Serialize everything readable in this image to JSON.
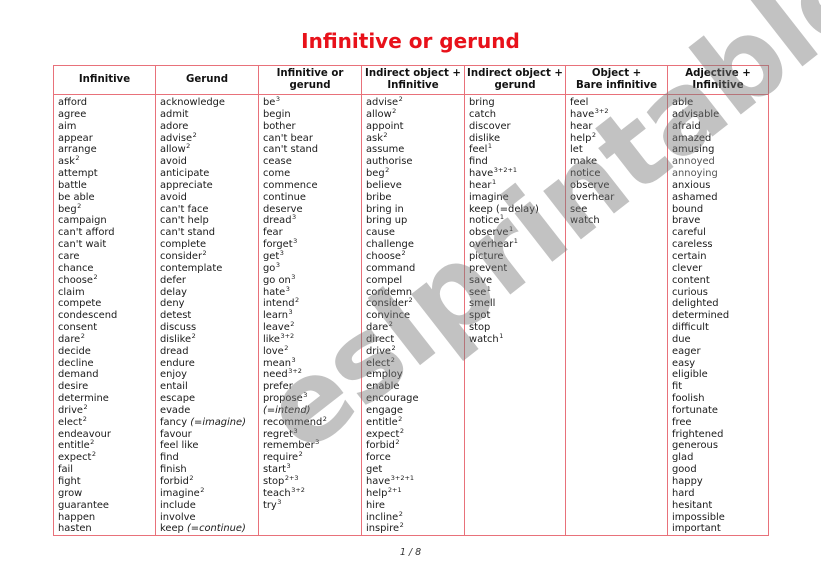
{
  "title": "Infinitive or gerund",
  "page_number": "1 / 8",
  "watermark": "eslprintables.com",
  "colors": {
    "title": "#e8111a",
    "border": "#e8717a"
  },
  "columns": [
    {
      "header": [
        "Infinitive",
        ""
      ],
      "items": [
        {
          "w": "afford"
        },
        {
          "w": "agree"
        },
        {
          "w": "aim"
        },
        {
          "w": "appear"
        },
        {
          "w": "arrange"
        },
        {
          "w": "ask",
          "sup": "2"
        },
        {
          "w": "attempt"
        },
        {
          "w": "battle"
        },
        {
          "w": "be able"
        },
        {
          "w": "beg",
          "sup": "2"
        },
        {
          "w": "campaign"
        },
        {
          "w": "can't afford"
        },
        {
          "w": "can't wait"
        },
        {
          "w": "care"
        },
        {
          "w": "chance"
        },
        {
          "w": "choose",
          "sup": "2"
        },
        {
          "w": "claim"
        },
        {
          "w": "compete"
        },
        {
          "w": "condescend"
        },
        {
          "w": "consent"
        },
        {
          "w": "dare",
          "sup": "2"
        },
        {
          "w": "decide"
        },
        {
          "w": "decline"
        },
        {
          "w": "demand"
        },
        {
          "w": "desire"
        },
        {
          "w": "determine"
        },
        {
          "w": "drive",
          "sup": "2"
        },
        {
          "w": "elect",
          "sup": "2"
        },
        {
          "w": "endeavour"
        },
        {
          "w": "entitle",
          "sup": "2"
        },
        {
          "w": "expect",
          "sup": "2"
        },
        {
          "w": "fail"
        },
        {
          "w": "fight"
        },
        {
          "w": "grow"
        },
        {
          "w": "guarantee"
        },
        {
          "w": "happen"
        },
        {
          "w": "hasten"
        }
      ]
    },
    {
      "header": [
        "Gerund",
        ""
      ],
      "items": [
        {
          "w": "acknowledge"
        },
        {
          "w": "admit"
        },
        {
          "w": "adore"
        },
        {
          "w": "advise",
          "sup": "2"
        },
        {
          "w": "allow",
          "sup": "2"
        },
        {
          "w": "avoid"
        },
        {
          "w": "anticipate"
        },
        {
          "w": "appreciate"
        },
        {
          "w": "avoid"
        },
        {
          "w": "can't face"
        },
        {
          "w": "can't help"
        },
        {
          "w": "can't stand"
        },
        {
          "w": "complete"
        },
        {
          "w": "consider",
          "sup": "2"
        },
        {
          "w": "contemplate"
        },
        {
          "w": "defer"
        },
        {
          "w": "delay"
        },
        {
          "w": "deny"
        },
        {
          "w": "detest"
        },
        {
          "w": "discuss"
        },
        {
          "w": "dislike",
          "sup": "2"
        },
        {
          "w": "dread"
        },
        {
          "w": "endure"
        },
        {
          "w": "enjoy"
        },
        {
          "w": "entail"
        },
        {
          "w": "escape"
        },
        {
          "w": "evade"
        },
        {
          "w": "fancy",
          "note": "(=imagine)"
        },
        {
          "w": "favour"
        },
        {
          "w": "feel like"
        },
        {
          "w": "find"
        },
        {
          "w": "finish"
        },
        {
          "w": "forbid",
          "sup": "2"
        },
        {
          "w": "imagine",
          "sup": "2"
        },
        {
          "w": "include"
        },
        {
          "w": "involve"
        },
        {
          "w": "keep",
          "note": "(=continue)"
        }
      ]
    },
    {
      "header": [
        "Infinitive or",
        "gerund"
      ],
      "items": [
        {
          "w": "be",
          "sup": "3"
        },
        {
          "w": "begin"
        },
        {
          "w": "bother"
        },
        {
          "w": "can't bear"
        },
        {
          "w": "can't stand"
        },
        {
          "w": "cease"
        },
        {
          "w": "come"
        },
        {
          "w": "commence"
        },
        {
          "w": "continue"
        },
        {
          "w": "deserve"
        },
        {
          "w": "dread",
          "sup": "3"
        },
        {
          "w": "fear"
        },
        {
          "w": "forget",
          "sup": "3"
        },
        {
          "w": "get",
          "sup": "3"
        },
        {
          "w": "go",
          "sup": "3"
        },
        {
          "w": "go on",
          "sup": "3"
        },
        {
          "w": "hate",
          "sup": "3"
        },
        {
          "w": "intend",
          "sup": "2"
        },
        {
          "w": "learn",
          "sup": "3"
        },
        {
          "w": "leave",
          "sup": "2"
        },
        {
          "w": "like",
          "sup": "3+2"
        },
        {
          "w": "love",
          "sup": "2"
        },
        {
          "w": "mean",
          "sup": "3"
        },
        {
          "w": "need",
          "sup": "3+2"
        },
        {
          "w": "prefer"
        },
        {
          "w": "propose",
          "sup": "3"
        },
        {
          "w": "",
          "note": "(=intend)"
        },
        {
          "w": "recommend",
          "sup": "2"
        },
        {
          "w": "regret",
          "sup": "3"
        },
        {
          "w": "remember",
          "sup": "3"
        },
        {
          "w": "require",
          "sup": "2"
        },
        {
          "w": "start",
          "sup": "3"
        },
        {
          "w": "stop",
          "sup": "2+3"
        },
        {
          "w": "teach",
          "sup": "3+2"
        },
        {
          "w": "try",
          "sup": "3"
        }
      ]
    },
    {
      "header": [
        "Indirect object +",
        "Infinitive"
      ],
      "items": [
        {
          "w": "advise",
          "sup": "2"
        },
        {
          "w": "allow",
          "sup": "2"
        },
        {
          "w": "appoint"
        },
        {
          "w": "ask",
          "sup": "2"
        },
        {
          "w": "assume"
        },
        {
          "w": "authorise"
        },
        {
          "w": "beg",
          "sup": "2"
        },
        {
          "w": "believe"
        },
        {
          "w": "bribe"
        },
        {
          "w": "bring in"
        },
        {
          "w": "bring up"
        },
        {
          "w": "cause"
        },
        {
          "w": "challenge"
        },
        {
          "w": "choose",
          "sup": "2"
        },
        {
          "w": "command"
        },
        {
          "w": "compel"
        },
        {
          "w": "condemn"
        },
        {
          "w": "consider",
          "sup": "2"
        },
        {
          "w": "convince"
        },
        {
          "w": "dare",
          "sup": "2"
        },
        {
          "w": "direct"
        },
        {
          "w": "drive",
          "sup": "2"
        },
        {
          "w": "elect",
          "sup": "2"
        },
        {
          "w": "employ"
        },
        {
          "w": "enable"
        },
        {
          "w": "encourage"
        },
        {
          "w": "engage"
        },
        {
          "w": "entitle",
          "sup": "2"
        },
        {
          "w": "expect",
          "sup": "2"
        },
        {
          "w": "forbid",
          "sup": "2"
        },
        {
          "w": "force"
        },
        {
          "w": "get"
        },
        {
          "w": "have",
          "sup": "3+2+1"
        },
        {
          "w": "help",
          "sup": "2+1"
        },
        {
          "w": "hire"
        },
        {
          "w": "incline",
          "sup": "2"
        },
        {
          "w": "inspire",
          "sup": "2"
        }
      ]
    },
    {
      "header": [
        "Indirect object +",
        "gerund"
      ],
      "items": [
        {
          "w": "bring"
        },
        {
          "w": "catch"
        },
        {
          "w": "discover"
        },
        {
          "w": "dislike"
        },
        {
          "w": "feel",
          "sup": "1"
        },
        {
          "w": "find"
        },
        {
          "w": "have",
          "sup": "3+2+1"
        },
        {
          "w": "hear",
          "sup": "1"
        },
        {
          "w": "imagine"
        },
        {
          "w": "keep (=delay)"
        },
        {
          "w": "notice",
          "sup": "1"
        },
        {
          "w": "observe",
          "sup": "1"
        },
        {
          "w": "overhear",
          "sup": "1"
        },
        {
          "w": "picture"
        },
        {
          "w": "prevent"
        },
        {
          "w": "save"
        },
        {
          "w": "see",
          "sup": "1"
        },
        {
          "w": "smell"
        },
        {
          "w": "spot"
        },
        {
          "w": "stop"
        },
        {
          "w": "watch",
          "sup": "1"
        }
      ]
    },
    {
      "header": [
        "Object +",
        "Bare infinitive"
      ],
      "items": [
        {
          "w": "feel"
        },
        {
          "w": "have",
          "sup": "3+2"
        },
        {
          "w": "hear"
        },
        {
          "w": "help",
          "sup": "2"
        },
        {
          "w": "let"
        },
        {
          "w": "make"
        },
        {
          "w": "notice"
        },
        {
          "w": "observe"
        },
        {
          "w": "overhear"
        },
        {
          "w": "see"
        },
        {
          "w": "watch"
        }
      ]
    },
    {
      "header": [
        "Adjective +",
        "Infinitive"
      ],
      "items": [
        {
          "w": "able"
        },
        {
          "w": "advisable"
        },
        {
          "w": "afraid"
        },
        {
          "w": "amazed"
        },
        {
          "w": "amusing"
        },
        {
          "w": "annoyed",
          "muted": true
        },
        {
          "w": "annoying",
          "muted": true
        },
        {
          "w": "anxious"
        },
        {
          "w": "ashamed"
        },
        {
          "w": "bound"
        },
        {
          "w": "brave"
        },
        {
          "w": "careful"
        },
        {
          "w": "careless"
        },
        {
          "w": "certain"
        },
        {
          "w": "clever"
        },
        {
          "w": "content"
        },
        {
          "w": "curious"
        },
        {
          "w": "delighted"
        },
        {
          "w": "determined"
        },
        {
          "w": "difficult"
        },
        {
          "w": "due"
        },
        {
          "w": "eager"
        },
        {
          "w": "easy"
        },
        {
          "w": "eligible"
        },
        {
          "w": "fit"
        },
        {
          "w": "foolish"
        },
        {
          "w": "fortunate"
        },
        {
          "w": "free"
        },
        {
          "w": "frightened"
        },
        {
          "w": "generous"
        },
        {
          "w": "glad"
        },
        {
          "w": "good"
        },
        {
          "w": "happy"
        },
        {
          "w": "hard"
        },
        {
          "w": "hesitant"
        },
        {
          "w": "impossible"
        },
        {
          "w": "important"
        }
      ]
    }
  ]
}
